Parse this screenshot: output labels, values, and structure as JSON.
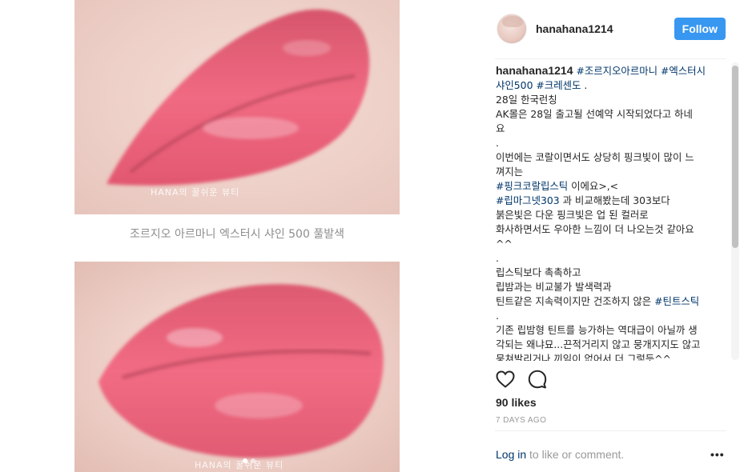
{
  "media": {
    "watermark_1": "HANA의 꿀쉬운 뷰티",
    "watermark_2": "HANA의 꿀쉬운 뷰티",
    "caption": "조르지오 아르마니 엑스터시 샤인 500 풀발색",
    "dots": 2,
    "active_dot": 0
  },
  "header": {
    "username": "hanahana1214",
    "follow_label": "Follow"
  },
  "post": {
    "author": "hanahana1214",
    "lines": [
      [
        {
          "t": "author",
          "v": "hanahana1214"
        },
        {
          "t": "text",
          "v": " "
        },
        {
          "t": "tag",
          "v": "#조르지오아르마니"
        },
        {
          "t": "text",
          "v": " "
        },
        {
          "t": "tag",
          "v": "#엑스터시"
        }
      ],
      [
        {
          "t": "tag",
          "v": "샤인500"
        },
        {
          "t": "text",
          "v": " "
        },
        {
          "t": "tag",
          "v": "#크레센도"
        },
        {
          "t": "text",
          "v": " ."
        }
      ],
      [
        {
          "t": "text",
          "v": "28일 한국런칭"
        }
      ],
      [
        {
          "t": "text",
          "v": "AK몰은 28일 출고될 선예약 시작되었다고 하네"
        }
      ],
      [
        {
          "t": "text",
          "v": "요"
        }
      ],
      [
        {
          "t": "text",
          "v": "."
        }
      ],
      [
        {
          "t": "text",
          "v": "이번에는 코랄이면서도 상당히 핑크빛이 많이 느"
        }
      ],
      [
        {
          "t": "text",
          "v": "껴지는"
        }
      ],
      [
        {
          "t": "tag",
          "v": "#핑크코랄립스틱"
        },
        {
          "t": "text",
          "v": " 이에요>,<"
        }
      ],
      [
        {
          "t": "tag",
          "v": "#립마그넷303"
        },
        {
          "t": "text",
          "v": " 과 비교해봤는데 303보다"
        }
      ],
      [
        {
          "t": "text",
          "v": "붉은빛은 다운 핑크빛은 업 된 컬러로"
        }
      ],
      [
        {
          "t": "text",
          "v": "화사하면서도 우아한 느낌이 더 나오는것 같아요"
        }
      ],
      [
        {
          "t": "text",
          "v": "^^"
        }
      ],
      [
        {
          "t": "text",
          "v": "."
        }
      ],
      [
        {
          "t": "text",
          "v": "립스틱보다 촉촉하고"
        }
      ],
      [
        {
          "t": "text",
          "v": "립밤과는 비교불가 발색력과"
        }
      ],
      [
        {
          "t": "text",
          "v": "틴트같은 지속력이지만 건조하지 않은 "
        },
        {
          "t": "tag",
          "v": "#틴트스틱"
        }
      ],
      [
        {
          "t": "text",
          "v": "."
        }
      ],
      [
        {
          "t": "text",
          "v": "기존 립밤형 틴트를 능가하는 역대급이 아닐까 생"
        }
      ],
      [
        {
          "t": "text",
          "v": "각되는 왜냐묘...끈적거리지 않고 뭉개지지도 않고"
        }
      ],
      [
        {
          "t": "text",
          "v": "뭉쳐발리거나 끼임이 없어서 더 그렇듯^^"
        }
      ]
    ]
  },
  "actions": {
    "like_icon": "heart-icon",
    "comment_icon": "comment-icon"
  },
  "likes": "90 likes",
  "time": "7 DAYS AGO",
  "footer": {
    "login_label": "Log in",
    "login_suffix": " to like or comment.",
    "more_label": "•••"
  },
  "colors": {
    "accent": "#3897f0",
    "link": "#003569",
    "lip": "#e0566d"
  }
}
